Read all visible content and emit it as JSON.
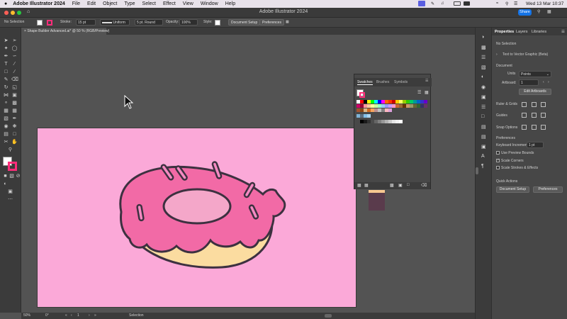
{
  "menubar": {
    "app_name": "Adobe Illustrator 2024",
    "items": [
      "File",
      "Edit",
      "Object",
      "Type",
      "Select",
      "Effect",
      "View",
      "Window",
      "Help"
    ],
    "datetime": "Wed 13 Mar  10:37"
  },
  "titlebar": {
    "title": "Adobe Illustrator 2024",
    "share_label": "Share"
  },
  "control_bar": {
    "selection_status": "No Selection",
    "stroke_label": "Stroke:",
    "stroke_value": "15 pt",
    "profile_value": "Uniform",
    "brush_value": "5 pt. Round",
    "opacity_label": "Opacity:",
    "opacity_value": "100%",
    "style_label": "Style:",
    "document_setup_label": "Document Setup",
    "preferences_label": "Preferences"
  },
  "document_tab": {
    "label": "Shape Builder Advanced.ai* @ 50 % (RGB/Preview)"
  },
  "swatches_panel": {
    "tabs": [
      "Swatches",
      "Brushes",
      "Symbols"
    ],
    "row1_colors": [
      "#ffffff",
      "#ff0000",
      "#000000",
      "#ffff00",
      "#00ff00",
      "#00ffff",
      "#0000ff",
      "#ff00ff",
      "#ff6600",
      "#ff3300",
      "#cc0000",
      "#ffcc00",
      "#ffff66",
      "#99cc00",
      "#33cc00",
      "#00cc66",
      "#009999",
      "#0066cc",
      "#3333cc",
      "#6600cc"
    ],
    "row2_colors": [
      "#cc0066",
      "#990033",
      "#ff9999",
      "#ffcc99",
      "#ffff99",
      "#ccff99",
      "#99ffcc",
      "#99ccff",
      "#9999ff",
      "#cc99ff",
      "#ff99cc",
      "#cc6633",
      "#996633",
      "#663300",
      "#cc9966",
      "#999966",
      "#666633",
      "#336633",
      "#333366",
      "#663366"
    ],
    "row3_colors": [
      "#a0522d",
      "#8b4513",
      "#deb887",
      "#d2691e",
      "#f4a460",
      "#bc8f8f",
      "#c0c0c0",
      "#808080",
      "#ffb6c1",
      "#dda0dd"
    ],
    "pattern_colors": [
      "#7fb3d5",
      "#5d6d7e",
      "#85c1e9",
      "#aed6f1"
    ],
    "gray_colors": [
      "#000000",
      "#1a1a1a",
      "#333333",
      "#4d4d4d",
      "#666666",
      "#808080",
      "#999999",
      "#b3b3b3",
      "#cccccc",
      "#e6e6e6",
      "#f2f2f2",
      "#ffffff"
    ]
  },
  "properties_panel": {
    "tabs": [
      "Properties",
      "Layers",
      "Libraries"
    ],
    "selection_status": "No Selection",
    "text_to_vector_label": "Text to Vector Graphic (Beta)",
    "document_header": "Document",
    "units_label": "Units",
    "units_value": "Points",
    "artboard_label": "Artboard:",
    "artboard_value": "1",
    "edit_artboards_label": "Edit Artboards",
    "ruler_grids_label": "Ruler & Grids",
    "guides_label": "Guides",
    "snap_options_label": "Snap Options",
    "preferences_header": "Preferences",
    "keyboard_increment_label": "Keyboard Increment:",
    "keyboard_increment_value": "1 pt",
    "use_preview_bounds_label": "Use Preview Bounds",
    "use_preview_bounds_checked": false,
    "scale_corners_label": "Scale Corners",
    "scale_corners_checked": true,
    "scale_strokes_label": "Scale Strokes & Effects",
    "scale_strokes_checked": false,
    "quick_actions_header": "Quick Actions",
    "document_setup_label": "Document Setup",
    "preferences_label": "Preferences"
  },
  "status_bar": {
    "zoom": "50%",
    "rotation": "0°",
    "artboard_number": "1",
    "tool_name": "Selection"
  },
  "colors": {
    "artboard_fill": "#fba9d8",
    "icing_fill": "#f26aa6",
    "dough_fill": "#fbdca0",
    "outline": "#3d3140"
  }
}
